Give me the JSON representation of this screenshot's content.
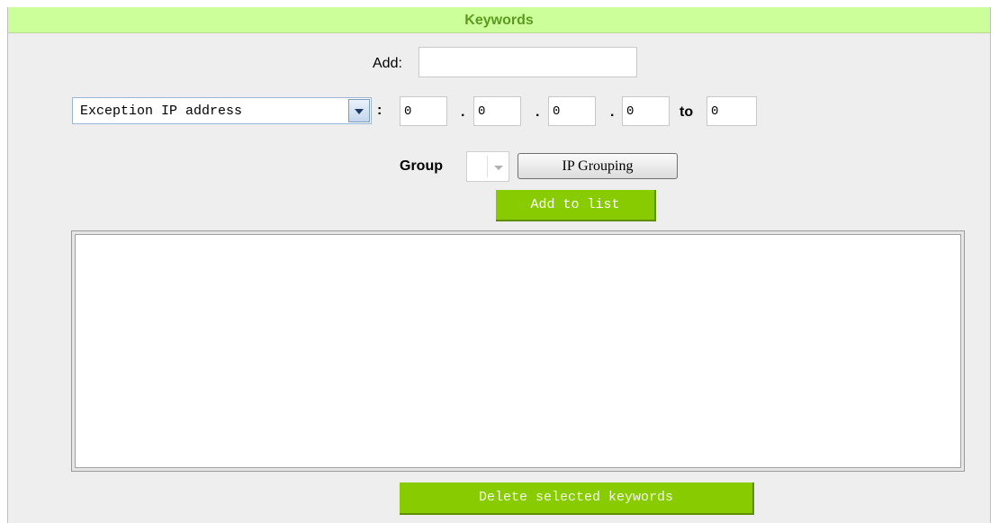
{
  "header": {
    "title": "Keywords"
  },
  "add": {
    "label": "Add:",
    "value": ""
  },
  "ip_type": {
    "selected": "Exception IP address"
  },
  "ip_range": {
    "colon": ":",
    "dot": ".",
    "to_label": "to",
    "octets": [
      "0",
      "0",
      "0",
      "0"
    ],
    "to_value": "0"
  },
  "group": {
    "label": "Group",
    "selected": ""
  },
  "buttons": {
    "ip_grouping": "IP Grouping",
    "add_to_list": "Add to list",
    "delete_selected": "Delete selected keywords"
  },
  "keyword_list": {
    "items": []
  },
  "colors": {
    "header_bg": "#ccff99",
    "header_text": "#5b9a1f",
    "button_green": "#88cc00",
    "panel_bg": "#eeeeee"
  },
  "icons": {
    "dropdown": "chevron-down-icon"
  }
}
